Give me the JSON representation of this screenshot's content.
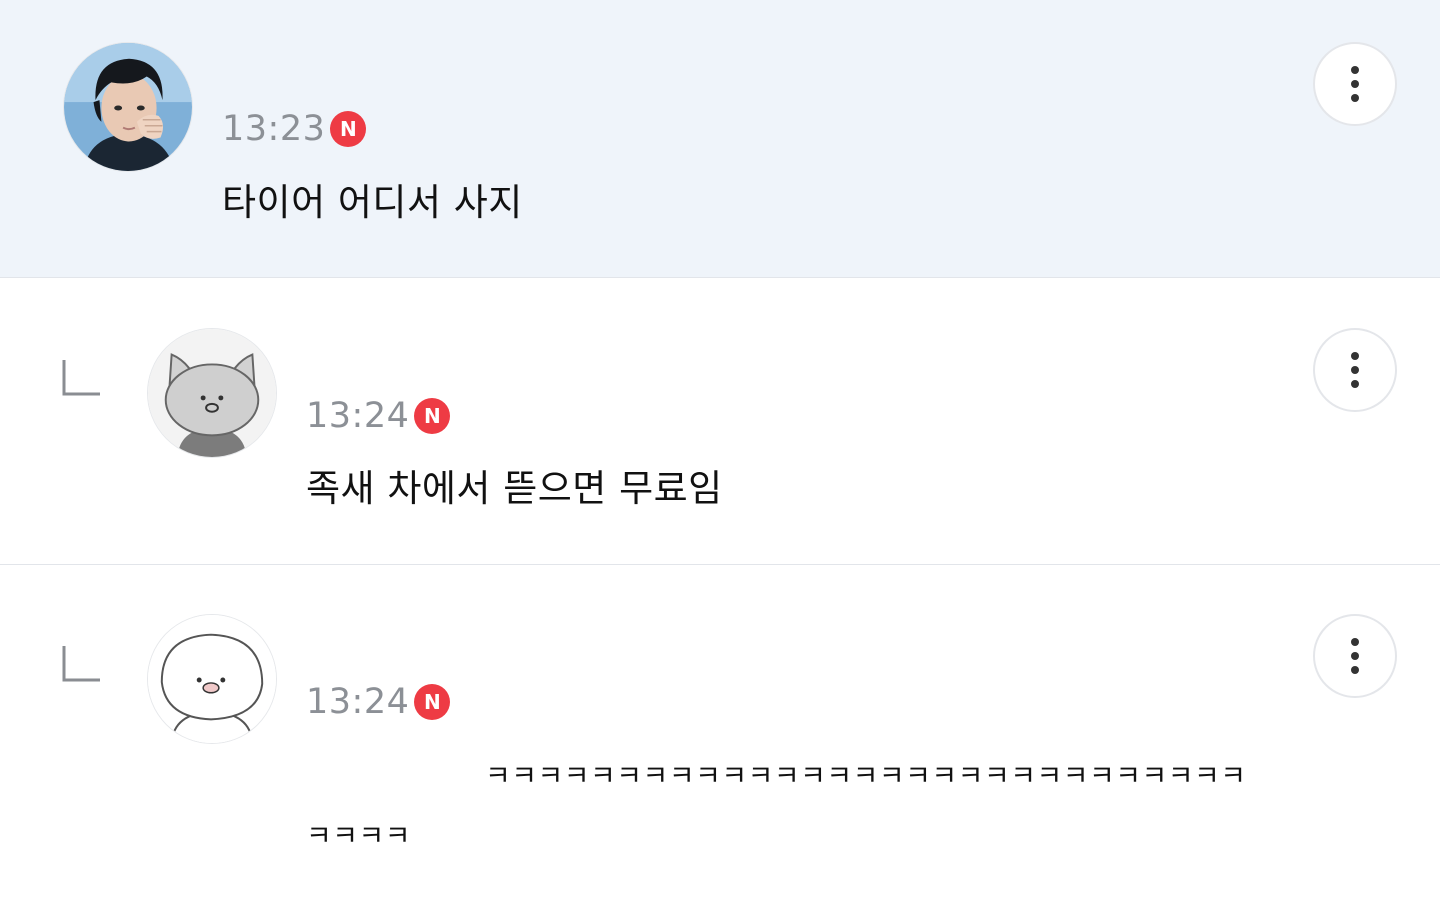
{
  "comments": [
    {
      "avatar": "profile-photo",
      "time": "13:23",
      "badge": "N",
      "text": "타이어 어디서 사지",
      "is_reply": false,
      "highlighted": true
    },
    {
      "avatar": "cat-character",
      "time": "13:24",
      "badge": "N",
      "text": "족새 차에서 뜯으면 무료임",
      "is_reply": true,
      "highlighted": false
    },
    {
      "avatar": "round-character",
      "time": "13:24",
      "badge": "N",
      "text_line1": "ㅋㅋㅋㅋㅋㅋㅋㅋㅋㅋㅋㅋㅋㅋㅋㅋㅋㅋㅋㅋㅋㅋㅋㅋㅋㅋㅋㅋㅋ",
      "text_line2": "ㅋㅋㅋㅋ",
      "is_reply": true,
      "highlighted": false
    }
  ],
  "icons": {
    "more": "vertical-ellipsis-icon",
    "reply": "reply-arrow-icon",
    "new_badge_color": "#ee3b44"
  },
  "colors": {
    "highlight_background": "#eff4fa",
    "time_text": "#8c9096",
    "body_text": "#111111"
  }
}
